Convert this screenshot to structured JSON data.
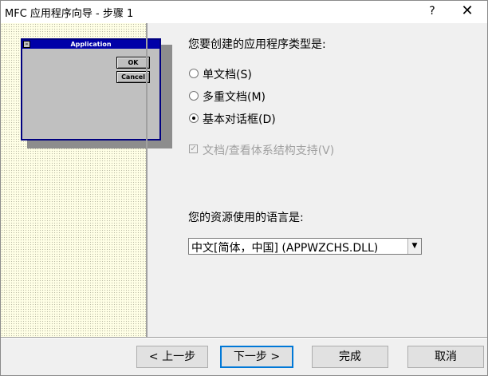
{
  "window": {
    "title": "MFC 应用程序向导 - 步骤 1",
    "help_label": "?",
    "close_label": "✕"
  },
  "preview": {
    "title": "Application",
    "ok_label": "OK",
    "cancel_label": "Cancel",
    "sys_glyph": "–"
  },
  "app_type": {
    "prompt": "您要创建的应用程序类型是:",
    "options": [
      {
        "label": "单文档(S)",
        "selected": false
      },
      {
        "label": "多重文档(M)",
        "selected": false
      },
      {
        "label": "基本对话框(D)",
        "selected": true
      }
    ]
  },
  "doc_view": {
    "label": "文档/查看体系结构支持(V)",
    "checked": true,
    "enabled": false,
    "check_glyph": "✓"
  },
  "language": {
    "prompt": "您的资源使用的语言是:",
    "selected": "中文[简体，中国] (APPWZCHS.DLL)",
    "arrow_glyph": "▼"
  },
  "buttons": {
    "back": "< 上一步",
    "next": "下一步 >",
    "finish": "完成",
    "cancel": "取消"
  }
}
